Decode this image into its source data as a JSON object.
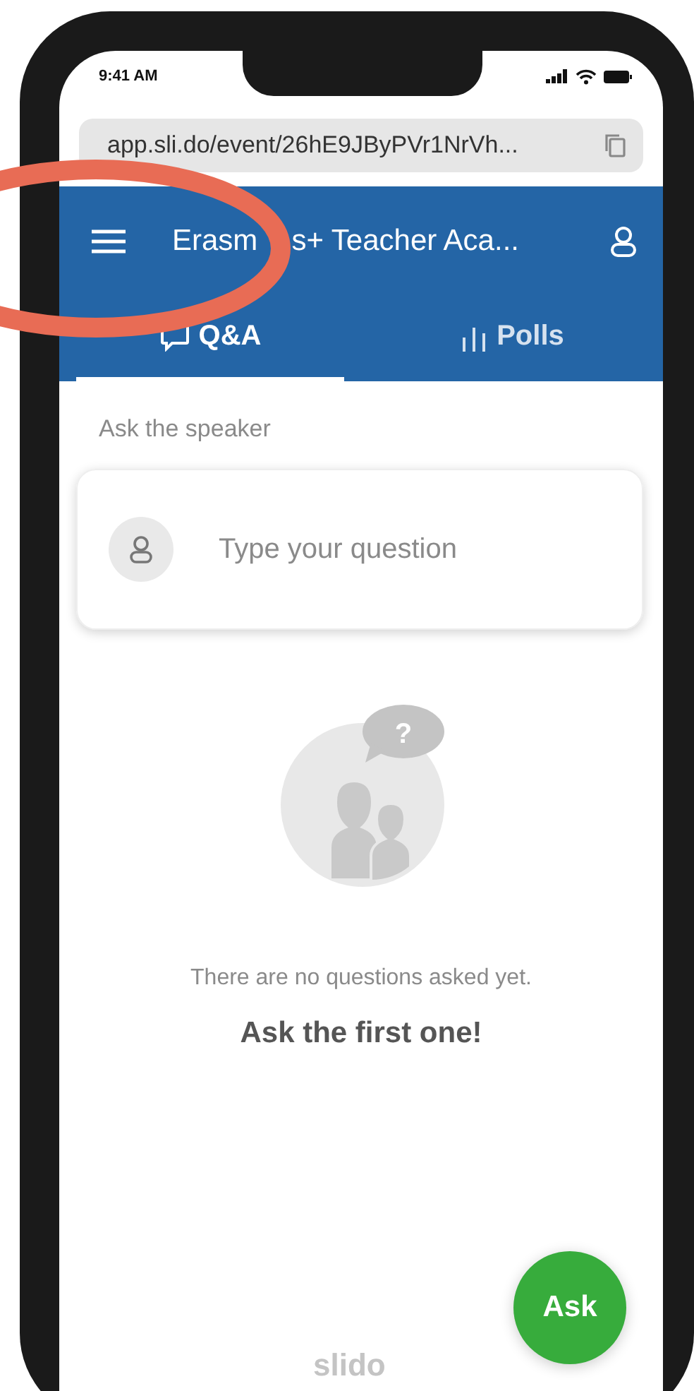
{
  "status_bar": {
    "time": "9:41 AM"
  },
  "address_bar": {
    "url": "app.sli.do/event/26hE9JByPVr1NrVh..."
  },
  "header": {
    "title_parts": [
      "Erasm",
      "s+ Teacher Aca..."
    ]
  },
  "tabs": [
    {
      "label": "Q&A",
      "selected": true,
      "kind": "qa"
    },
    {
      "label": "Polls",
      "selected": false,
      "kind": "polls"
    }
  ],
  "section_label": "Ask the speaker",
  "question_field": {
    "placeholder": "Type your question"
  },
  "empty_state": {
    "bubble_mark": "?",
    "message": "There are no questions asked yet.",
    "call_to_action": "Ask the first one!"
  },
  "footer": {
    "logo": "slido"
  },
  "ask_button": {
    "label": "Ask"
  }
}
